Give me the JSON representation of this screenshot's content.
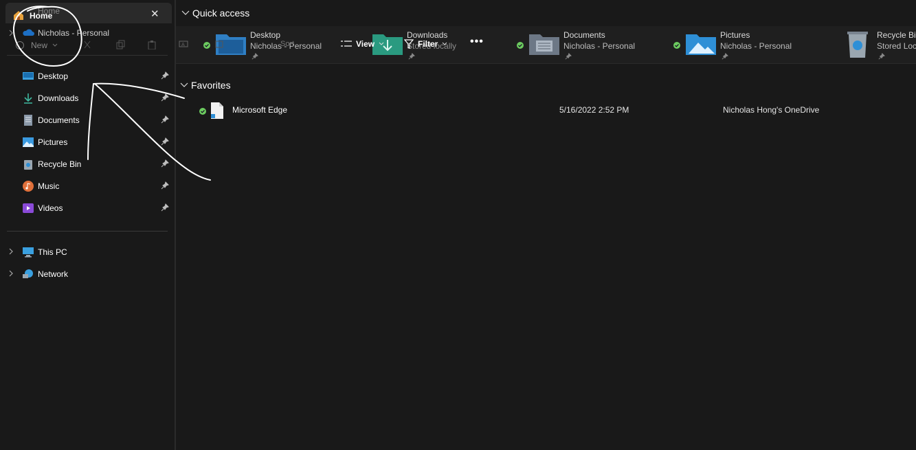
{
  "tab": {
    "title": "Home",
    "ghost_title": "Home",
    "close": "✕"
  },
  "ghost": {
    "root_label": "Nicholas - Personal",
    "new_label": "New"
  },
  "sidebar": {
    "pinned": [
      {
        "label": "Desktop"
      },
      {
        "label": "Downloads"
      },
      {
        "label": "Documents"
      },
      {
        "label": "Pictures"
      },
      {
        "label": "Recycle Bin"
      },
      {
        "label": "Music"
      },
      {
        "label": "Videos"
      }
    ],
    "drives": [
      {
        "label": "This PC"
      },
      {
        "label": "Network"
      }
    ]
  },
  "quick_access": {
    "title": "Quick access",
    "tiles": [
      {
        "name": "Desktop",
        "sub": "Nicholas - Personal"
      },
      {
        "name": "Downloads",
        "sub": "Stored locally"
      },
      {
        "name": "Documents",
        "sub": "Nicholas - Personal"
      },
      {
        "name": "Pictures",
        "sub": "Nicholas - Personal"
      },
      {
        "name": "Recycle Bin",
        "sub": "Stored Loc"
      }
    ]
  },
  "toolbar": {
    "view_label": "View",
    "filter_label": "Filter",
    "more_label": "•••",
    "ghost_sort": "Sort"
  },
  "favorites": {
    "title": "Favorites",
    "rows": [
      {
        "name": "Microsoft Edge",
        "date": "5/16/2022 2:52 PM",
        "location": "Nicholas Hong's OneDrive"
      }
    ]
  },
  "colors": {
    "background": "#191919",
    "accent_blue": "#2f8fd8",
    "sync_green": "#6ccb5f",
    "annotation": "#ffffff"
  }
}
